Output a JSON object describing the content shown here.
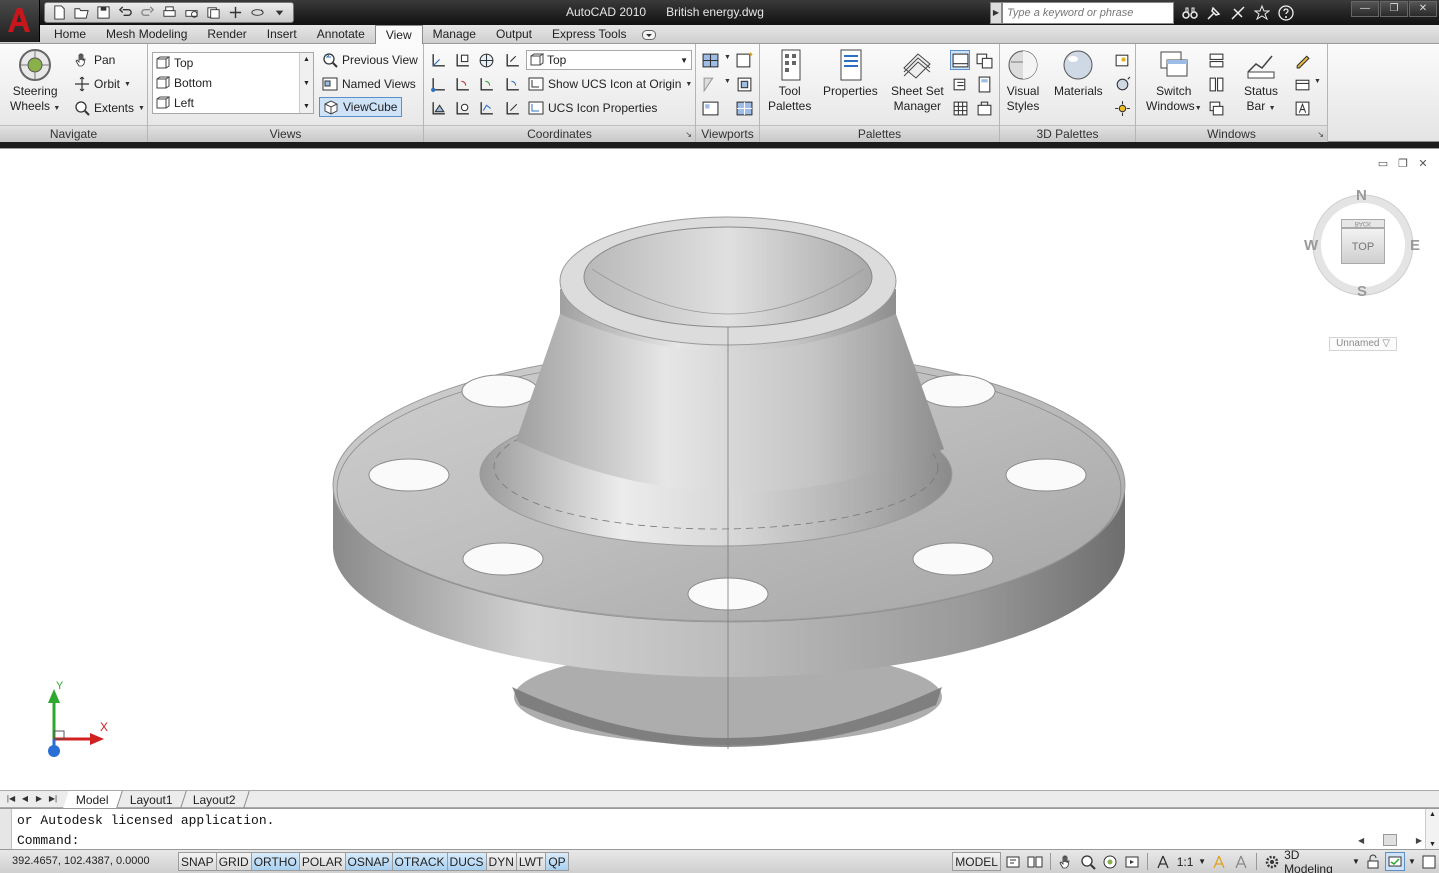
{
  "window": {
    "app_title": "AutoCAD 2010",
    "doc_title": "British energy.dwg",
    "search_placeholder": "Type a keyword or phrase",
    "controls": [
      "—",
      "❐",
      "✕"
    ]
  },
  "ribbon": {
    "tabs": [
      "Home",
      "Mesh Modeling",
      "Render",
      "Insert",
      "Annotate",
      "View",
      "Manage",
      "Output",
      "Express Tools"
    ],
    "active_tab": "View",
    "navigate": {
      "title": "Navigate",
      "steering_line1": "Steering",
      "steering_line2": "Wheels",
      "pan": "Pan",
      "orbit": "Orbit",
      "extents": "Extents"
    },
    "views": {
      "title": "Views",
      "list": [
        "Top",
        "Bottom",
        "Left"
      ],
      "previous_view": "Previous View",
      "named_views": "Named Views",
      "viewcube": "ViewCube"
    },
    "coordinates": {
      "title": "Coordinates",
      "view_combo": "Top",
      "show_ucs": "Show UCS Icon at Origin",
      "ucs_properties": "UCS Icon Properties"
    },
    "viewports": {
      "title": "Viewports"
    },
    "palettes": {
      "title": "Palettes",
      "tool_line1": "Tool",
      "tool_line2": "Palettes",
      "properties": "Properties",
      "sheet_line1": "Sheet Set",
      "sheet_line2": "Manager"
    },
    "palettes3d": {
      "title": "3D Palettes",
      "visual_line1": "Visual",
      "visual_line2": "Styles",
      "materials": "Materials"
    },
    "windows": {
      "title": "Windows",
      "switch_line1": "Switch",
      "switch_line2": "Windows",
      "status_line1": "Status",
      "status_line2": "Bar"
    }
  },
  "viewport": {
    "viewcube": {
      "n": "N",
      "s": "S",
      "e": "E",
      "w": "W",
      "face": "TOP",
      "back": "BACK"
    },
    "wcs_menu": "Unnamed",
    "ucs_x": "X",
    "ucs_y": "Y"
  },
  "layout_tabs": [
    "Model",
    "Layout1",
    "Layout2"
  ],
  "active_layout": "Model",
  "command": {
    "history": "or Autodesk licensed application.",
    "prompt": "Command:"
  },
  "status": {
    "coords": "392.4657, 102.4387, 0.0000",
    "toggles": [
      {
        "label": "SNAP",
        "on": false
      },
      {
        "label": "GRID",
        "on": false
      },
      {
        "label": "ORTHO",
        "on": true
      },
      {
        "label": "POLAR",
        "on": false
      },
      {
        "label": "OSNAP",
        "on": true
      },
      {
        "label": "OTRACK",
        "on": true
      },
      {
        "label": "DUCS",
        "on": true
      },
      {
        "label": "DYN",
        "on": false
      },
      {
        "label": "LWT",
        "on": false
      },
      {
        "label": "QP",
        "on": true
      }
    ],
    "model": "MODEL",
    "scale": "1:1",
    "workspace": "3D Modeling"
  }
}
